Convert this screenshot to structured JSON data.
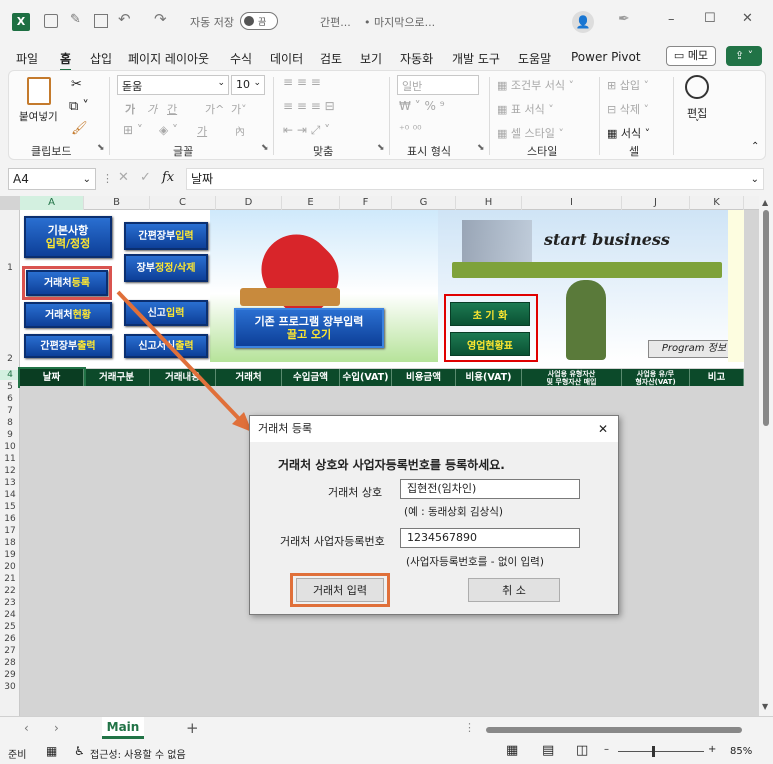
{
  "titlebar": {
    "autosave_label": "자동 저장",
    "autosave_state": "끔",
    "filename": "간편...",
    "location": "• 마지막으로...",
    "minimize": "–",
    "maximize": "☐",
    "close": "✕"
  },
  "tabs": [
    "파일",
    "홈",
    "삽입",
    "페이지 레이아웃",
    "수식",
    "데이터",
    "검토",
    "보기",
    "자동화",
    "개발 도구",
    "도움말",
    "Power Pivot"
  ],
  "active_tab": "홈",
  "memo_button": "메모",
  "ribbon": {
    "clipboard": {
      "label": "클립보드",
      "paste": "붙여넣기"
    },
    "font": {
      "label": "글꼴",
      "font_name": "돋움",
      "font_size": "10",
      "bold": "가",
      "italic": "가",
      "underline": "간",
      "grow": "가^",
      "shrink": "가˅",
      "phonetic": "가"
    },
    "alignment": {
      "label": "맞춤"
    },
    "number": {
      "label": "표시 형식",
      "format": "일반"
    },
    "styles": {
      "label": "스타일",
      "conditional": "조건부 서식",
      "table": "표 서식",
      "cell": "셀 스타일"
    },
    "cells": {
      "label": "셀",
      "insert": "삽입",
      "delete": "삭제",
      "format": "서식"
    },
    "editing": {
      "label": "편집"
    }
  },
  "formula_bar": {
    "cell_ref": "A4",
    "fx": "fx",
    "value": "날짜"
  },
  "columns": [
    "A",
    "B",
    "C",
    "D",
    "E",
    "F",
    "G",
    "H",
    "I",
    "J",
    "K"
  ],
  "rows": [
    "1",
    "2",
    "4",
    "5",
    "6",
    "7",
    "8",
    "9",
    "10",
    "11",
    "12",
    "13",
    "14",
    "15",
    "16",
    "17",
    "18",
    "19",
    "20",
    "21",
    "22",
    "23",
    "24",
    "25",
    "26",
    "27",
    "28",
    "29",
    "30"
  ],
  "banner": {
    "btn_basic": [
      "기본사항",
      "입력/정정"
    ],
    "btn_ledger_input": [
      "간편장부 ",
      "입력"
    ],
    "btn_ledger_edit": [
      "장부 ",
      "정정/삭제"
    ],
    "btn_vendor_reg": [
      "거래처 ",
      "등록"
    ],
    "btn_vendor_status": [
      "거래처 ",
      "현황"
    ],
    "btn_report_input": [
      "신고 ",
      "입력"
    ],
    "btn_ledger_print": [
      "간편장부 ",
      "출력"
    ],
    "btn_report_print": [
      "신고서식 ",
      "출력"
    ],
    "btn_import": [
      "기존 프로그램 장부입력",
      "끌고 오기"
    ],
    "btn_init": "초 기 화",
    "btn_business": "영업현황표",
    "banner_text": "start business",
    "program_info": "Program 정보"
  },
  "header_cells": [
    "날짜",
    "거래구분",
    "거래내용",
    "거래처",
    "수입금액",
    "수입(VAT)",
    "비용금액",
    "비용(VAT)",
    "사업용 유형자산\n및 무형자산 매입",
    "사업용 유/무\n형자산(VAT)",
    "비고"
  ],
  "dialog": {
    "title": "거래처 등록",
    "close": "✕",
    "heading": "거래처 상호와 사업자등록번호를 등록하세요.",
    "name_label": "거래처 상호",
    "name_value": "집현전(임차인)",
    "name_hint": "(예 : 동래상회 김상식)",
    "reg_label": "거래처 사업자등록번호",
    "reg_value": "1234567890",
    "reg_hint": "(사업자등록번호를 - 없이 입력)",
    "submit": "거래처 입력",
    "cancel": "취  소"
  },
  "sheet_tab": "Main",
  "status": {
    "ready": "준비",
    "accessibility": "접근성: 사용할 수 없음",
    "zoom": "85%"
  },
  "colors": {
    "accent": "#217346",
    "highlight": "#d9534f",
    "header_green": "#0c4a2a",
    "button_blue": "#1657b8"
  }
}
